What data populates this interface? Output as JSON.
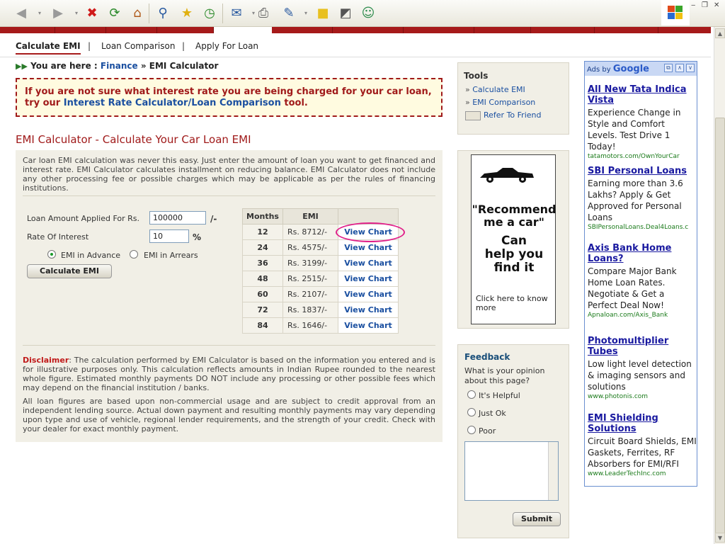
{
  "toolbar": {
    "items": [
      "back-icon",
      "forward-icon",
      "stop-icon",
      "refresh-icon",
      "home-icon",
      "search-icon",
      "favorites-icon",
      "history-icon",
      "mail-icon",
      "print-icon",
      "edit-icon",
      "notes-icon",
      "research-icon",
      "messenger-icon"
    ]
  },
  "nav": {
    "tabs": [
      "Calculate EMI",
      "Loan Comparison",
      "Apply For Loan"
    ],
    "separator": "|"
  },
  "breadcrumb": {
    "prefix": "You are here :",
    "finance": "Finance",
    "sep": "»",
    "current": "EMI Calculator"
  },
  "notice": {
    "line1": "If you are not sure what interest rate you are being charged for your car loan,",
    "try": "try our",
    "link": "Interest Rate Calculator/Loan Comparison",
    "tool": "tool."
  },
  "heading": "EMI Calculator - Calculate Your Car Loan EMI",
  "intro": "Car loan EMI calculation was never this easy. Just enter the amount of loan you want to get financed and interest rate. EMI Calculator calculates installment on reducing balance. EMI Calculator does not include any other processing fee or possible charges which may be applicable as per the rules of financing institutions.",
  "form": {
    "amount_label": "Loan Amount Applied For Rs.",
    "amount_value": "100000",
    "amount_suffix": "/-",
    "rate_label": "Rate Of Interest",
    "rate_value": "10",
    "rate_suffix": "%",
    "advance_label": "EMI in Advance",
    "arrears_label": "EMI in Arrears",
    "calculate_label": "Calculate EMI"
  },
  "emi_table": {
    "headers": [
      "Months",
      "EMI"
    ],
    "link_label": "View Chart",
    "rows": [
      {
        "months": "12",
        "emi": "Rs. 8712/-"
      },
      {
        "months": "24",
        "emi": "Rs. 4575/-"
      },
      {
        "months": "36",
        "emi": "Rs. 3199/-"
      },
      {
        "months": "48",
        "emi": "Rs. 2515/-"
      },
      {
        "months": "60",
        "emi": "Rs. 2107/-"
      },
      {
        "months": "72",
        "emi": "Rs. 1837/-"
      },
      {
        "months": "84",
        "emi": "Rs. 1646/-"
      }
    ]
  },
  "disclaimer": {
    "label": "Disclaimer",
    "text": ": The calculation performed by EMI Calculator is based on the information you entered and is for illustrative purposes only. This calculation reflects amounts in Indian Rupee rounded to the nearest whole figure. Estimated monthly payments DO NOT include any processing or other possible fees which may depend on the financial institution / banks.",
    "text2": "All loan figures are based upon non-commercial usage and are subject to credit approval from an independent lending source. Actual down payment and resulting monthly payments may vary depending upon type and use of vehicle, regional lender requirements, and the strength of your credit. Check with your dealer for exact monthly payment."
  },
  "tools": {
    "title": "Tools",
    "items": [
      "Calculate EMI",
      "EMI Comparison",
      "Refer To Friend"
    ],
    "marker": "»"
  },
  "banner": {
    "line1": "\"Recommend",
    "line2": "me a car\"",
    "line3": "Can",
    "line4": "help you",
    "line5": "find it",
    "small": "Click here to know more"
  },
  "feedback": {
    "title": "Feedback",
    "question": "What is your opinion about this page?",
    "options": [
      "It's Helpful",
      "Just Ok",
      "Poor"
    ],
    "submit": "Submit"
  },
  "ads": {
    "by": "Ads by",
    "google": "Google",
    "items": [
      {
        "title": "All New Tata Indica Vista",
        "desc": "Experience Change in Style and Comfort Levels. Test Drive 1 Today!",
        "url": "tatamotors.com/OwnYourCar"
      },
      {
        "title": "SBI Personal Loans",
        "desc": "Earning more than 3.6 Lakhs? Apply & Get Approved for Personal Loans",
        "url": "SBIPersonalLoans.Deal4Loans.c"
      },
      {
        "title": "Axis Bank Home Loans?",
        "desc": "Compare Major Bank Home Loan Rates. Negotiate & Get a Perfect Deal Now!",
        "url": "Apnaloan.com/Axis_Bank"
      },
      {
        "title": "Photomultiplier Tubes",
        "desc": "Low light level detection & imaging sensors and solutions",
        "url": "www.photonis.com"
      },
      {
        "title": "EMI Shielding Solutions",
        "desc": "Circuit Board Shields, EMI Gaskets, Ferrites, RF Absorbers for EMI/RFI",
        "url": "www.LeaderTechInc.com"
      }
    ]
  },
  "colors": {
    "brand_red": "#a61a1a",
    "link_blue": "#1a4fa0",
    "highlight_pink": "#e0208a"
  }
}
